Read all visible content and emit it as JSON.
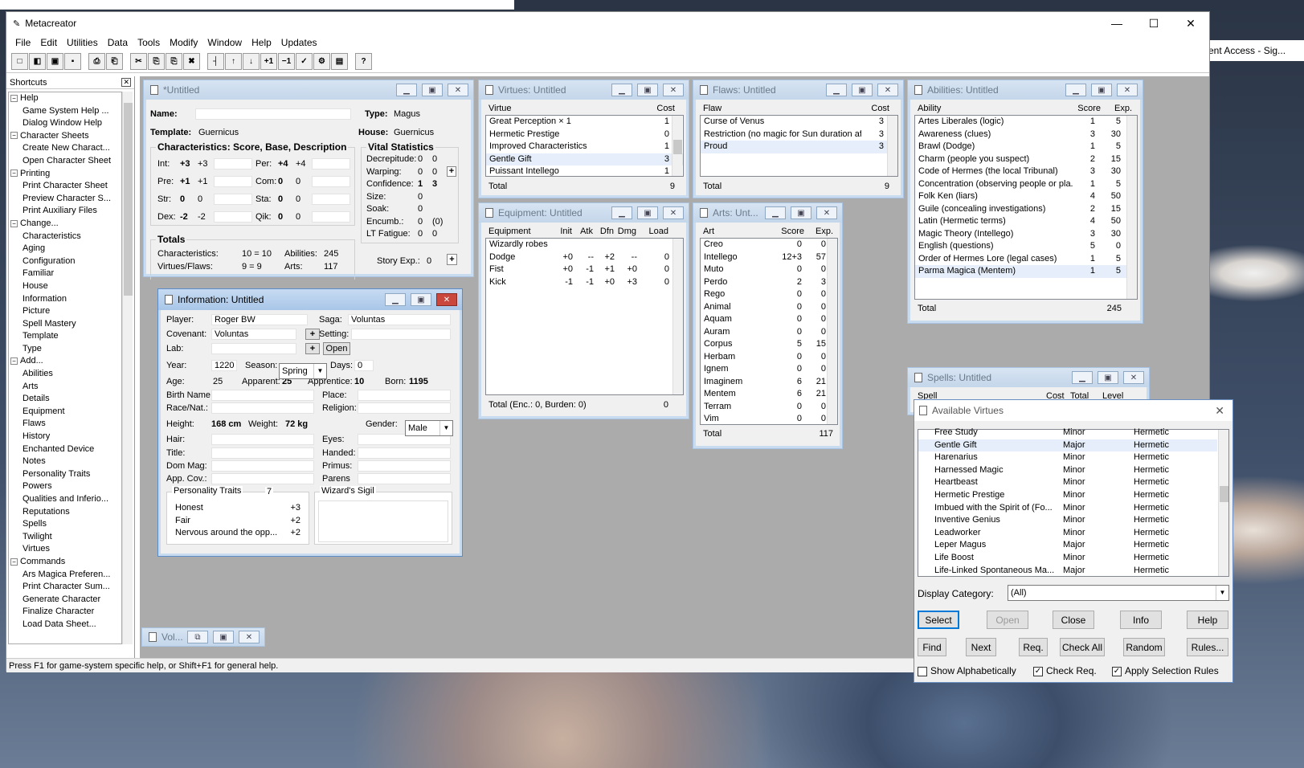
{
  "browser": {
    "right_tab_text": "ent Access - Sig..."
  },
  "app": {
    "title": "Metacreator",
    "min": "—",
    "max": "☐",
    "close": "✕"
  },
  "menu": [
    "File",
    "Edit",
    "Utilities",
    "Data",
    "Tools",
    "Modify",
    "Window",
    "Help",
    "Updates"
  ],
  "toolbar": [
    "□",
    "◧",
    "▣",
    "▪",
    "⎙",
    "⎗",
    "✂",
    "⎘",
    "⎘",
    "✖",
    "┤",
    "↑",
    "↓",
    "+1",
    "−1",
    "✓",
    "⚙",
    "▤",
    "?"
  ],
  "shortcuts": {
    "title": "Shortcuts",
    "close": "✕",
    "items": [
      {
        "t": "g",
        "label": "Help"
      },
      {
        "t": "s",
        "label": "Game System Help ..."
      },
      {
        "t": "s",
        "label": "Dialog Window Help"
      },
      {
        "t": "g",
        "label": "Character Sheets"
      },
      {
        "t": "s",
        "label": "Create New Charact..."
      },
      {
        "t": "s",
        "label": "Open Character Sheet"
      },
      {
        "t": "g",
        "label": "Printing"
      },
      {
        "t": "s",
        "label": "Print Character Sheet"
      },
      {
        "t": "s",
        "label": "Preview Character S..."
      },
      {
        "t": "s",
        "label": "Print Auxiliary Files"
      },
      {
        "t": "g",
        "label": "Change..."
      },
      {
        "t": "s",
        "label": "Characteristics"
      },
      {
        "t": "s",
        "label": "Aging"
      },
      {
        "t": "s",
        "label": "Configuration"
      },
      {
        "t": "s",
        "label": "Familiar"
      },
      {
        "t": "s",
        "label": "House"
      },
      {
        "t": "s",
        "label": "Information"
      },
      {
        "t": "s",
        "label": "Picture"
      },
      {
        "t": "s",
        "label": "Spell Mastery"
      },
      {
        "t": "s",
        "label": "Template"
      },
      {
        "t": "s",
        "label": "Type"
      },
      {
        "t": "g",
        "label": "Add..."
      },
      {
        "t": "s",
        "label": "Abilities"
      },
      {
        "t": "s",
        "label": "Arts"
      },
      {
        "t": "s",
        "label": "Details"
      },
      {
        "t": "s",
        "label": "Equipment"
      },
      {
        "t": "s",
        "label": "Flaws"
      },
      {
        "t": "s",
        "label": "History"
      },
      {
        "t": "s",
        "label": "Enchanted Device"
      },
      {
        "t": "s",
        "label": "Notes"
      },
      {
        "t": "s",
        "label": "Personality Traits"
      },
      {
        "t": "s",
        "label": "Powers"
      },
      {
        "t": "s",
        "label": "Qualities and Inferio..."
      },
      {
        "t": "s",
        "label": "Reputations"
      },
      {
        "t": "s",
        "label": "Spells"
      },
      {
        "t": "s",
        "label": "Twilight"
      },
      {
        "t": "s",
        "label": "Virtues"
      },
      {
        "t": "g",
        "label": "Commands"
      },
      {
        "t": "s",
        "label": "Ars Magica Preferen..."
      },
      {
        "t": "s",
        "label": "Print Character Sum..."
      },
      {
        "t": "s",
        "label": "Generate Character"
      },
      {
        "t": "s",
        "label": "Finalize Character"
      },
      {
        "t": "s",
        "label": "Load Data Sheet..."
      }
    ]
  },
  "status": "Press F1 for game-system specific help, or Shift+F1 for general help.",
  "char": {
    "title": "*Untitled",
    "name_label": "Name:",
    "name": "",
    "type_label": "Type:",
    "type": "Magus",
    "template_label": "Template:",
    "template": "Guernicus",
    "house_label": "House:",
    "house": "Guernicus",
    "chars_title": "Characteristics: Score, Base, Description",
    "chars": [
      {
        "k": "Int:",
        "s": "+3",
        "b": "+3"
      },
      {
        "k": "Pre:",
        "s": "+1",
        "b": "+1"
      },
      {
        "k": "Str:",
        "s": "0",
        "b": "0"
      },
      {
        "k": "Dex:",
        "s": "-2",
        "b": "-2"
      },
      {
        "k": "Per:",
        "s": "+4",
        "b": "+4"
      },
      {
        "k": "Com:",
        "s": "0",
        "b": "0"
      },
      {
        "k": "Sta:",
        "s": "0",
        "b": "0"
      },
      {
        "k": "Qik:",
        "s": "0",
        "b": "0"
      }
    ],
    "vital_title": "Vital Statistics",
    "vital": [
      {
        "k": "Decrepitude:",
        "a": "0",
        "b": "0"
      },
      {
        "k": "Warping:",
        "a": "0",
        "b": "0"
      },
      {
        "k": "Confidence:",
        "a": "1",
        "b": "3"
      },
      {
        "k": "Size:",
        "a": "0",
        "b": ""
      },
      {
        "k": "Soak:",
        "a": "0",
        "b": ""
      },
      {
        "k": "Encumb.:",
        "a": "0",
        "b": "(0)"
      },
      {
        "k": "LT Fatigue:",
        "a": "0",
        "b": "0"
      }
    ],
    "totals_title": "Totals",
    "tot_chars_label": "Characteristics:",
    "tot_chars": "10  =  10",
    "tot_abil_label": "Abilities:",
    "tot_abil": "245",
    "tot_vf_label": "Virtues/Flaws:",
    "tot_vf": "9  =  9",
    "tot_arts_label": "Arts:",
    "tot_arts": "117",
    "story_label": "Story Exp.:",
    "story": "0",
    "plus": "+"
  },
  "virtues": {
    "title": "Virtues: Untitled",
    "h1": "Virtue",
    "h2": "Cost",
    "rows": [
      {
        "n": "Great Perception × 1",
        "c": "1"
      },
      {
        "n": "Hermetic Prestige",
        "c": "0"
      },
      {
        "n": "Improved Characteristics",
        "c": "1"
      },
      {
        "n": "Gentle Gift",
        "c": "3"
      },
      {
        "n": "Puissant Intellego",
        "c": "1"
      }
    ],
    "total_label": "Total",
    "total": "9"
  },
  "flaws": {
    "title": "Flaws: Untitled",
    "h1": "Flaw",
    "h2": "Cost",
    "rows": [
      {
        "n": "Curse of Venus",
        "c": "3"
      },
      {
        "n": "Restriction (no magic for Sun duration af...",
        "c": "3"
      },
      {
        "n": "Proud",
        "c": "3"
      }
    ],
    "total_label": "Total",
    "total": "9"
  },
  "abilities": {
    "title": "Abilities: Untitled",
    "h1": "Ability",
    "h2": "Score",
    "h3": "Exp.",
    "rows": [
      {
        "n": "Artes Liberales (logic)",
        "s": "1",
        "e": "5"
      },
      {
        "n": "Awareness (clues)",
        "s": "3",
        "e": "30"
      },
      {
        "n": "Brawl (Dodge)",
        "s": "1",
        "e": "5"
      },
      {
        "n": "Charm (people you suspect)",
        "s": "2",
        "e": "15"
      },
      {
        "n": "Code of Hermes (the local Tribunal)",
        "s": "3",
        "e": "30"
      },
      {
        "n": "Concentration (observing people or pla...",
        "s": "1",
        "e": "5"
      },
      {
        "n": "Folk Ken (liars)",
        "s": "4",
        "e": "50"
      },
      {
        "n": "Guile (concealing investigations)",
        "s": "2",
        "e": "15"
      },
      {
        "n": "Latin (Hermetic terms)",
        "s": "4",
        "e": "50"
      },
      {
        "n": "Magic Theory (Intellego)",
        "s": "3",
        "e": "30"
      },
      {
        "n": "English (questions)",
        "s": "5",
        "e": "0"
      },
      {
        "n": "Order of Hermes Lore (legal cases)",
        "s": "1",
        "e": "5"
      },
      {
        "n": "Parma Magica (Mentem)",
        "s": "1",
        "e": "5"
      }
    ],
    "total_label": "Total",
    "total": "245"
  },
  "equipment": {
    "title": "Equipment: Untitled",
    "heads": [
      "Equipment",
      "Init",
      "Atk",
      "Dfn",
      "Dmg",
      "Load"
    ],
    "rows": [
      {
        "n": "Wizardly robes",
        "i": "",
        "a": "",
        "d": "",
        "g": "",
        "l": ""
      },
      {
        "n": "Dodge",
        "i": "+0",
        "a": "--",
        "d": "+2",
        "g": "--",
        "l": "0"
      },
      {
        "n": "Fist",
        "i": "+0",
        "a": "-1",
        "d": "+1",
        "g": "+0",
        "l": "0"
      },
      {
        "n": "Kick",
        "i": "-1",
        "a": "-1",
        "d": "+0",
        "g": "+3",
        "l": "0"
      }
    ],
    "total_label": "Total (Enc.: 0, Burden: 0)",
    "total": "0"
  },
  "arts": {
    "title": "Arts: Unt...",
    "h1": "Art",
    "h2": "Score",
    "h3": "Exp.",
    "rows": [
      {
        "n": "Creo",
        "s": "0",
        "e": "0"
      },
      {
        "n": "Intellego",
        "s": "12+3",
        "e": "57"
      },
      {
        "n": "Muto",
        "s": "0",
        "e": "0"
      },
      {
        "n": "Perdo",
        "s": "2",
        "e": "3"
      },
      {
        "n": "Rego",
        "s": "0",
        "e": "0"
      },
      {
        "n": "Animal",
        "s": "0",
        "e": "0"
      },
      {
        "n": "Aquam",
        "s": "0",
        "e": "0"
      },
      {
        "n": "Auram",
        "s": "0",
        "e": "0"
      },
      {
        "n": "Corpus",
        "s": "5",
        "e": "15"
      },
      {
        "n": "Herbam",
        "s": "0",
        "e": "0"
      },
      {
        "n": "Ignem",
        "s": "0",
        "e": "0"
      },
      {
        "n": "Imaginem",
        "s": "6",
        "e": "21"
      },
      {
        "n": "Mentem",
        "s": "6",
        "e": "21"
      },
      {
        "n": "Terram",
        "s": "0",
        "e": "0"
      },
      {
        "n": "Vim",
        "s": "0",
        "e": "0"
      }
    ],
    "total_label": "Total",
    "total": "117"
  },
  "spells": {
    "title": "Spells: Untitled",
    "h1": "Spell",
    "h2": "Cost",
    "h3": "Total",
    "h4": "Level"
  },
  "minimized": {
    "title": "Vol..."
  },
  "info": {
    "title": "Information: Untitled",
    "player_label": "Player:",
    "player": "Roger BW",
    "saga_label": "Saga:",
    "saga": "Voluntas",
    "covenant_label": "Covenant:",
    "covenant": "Voluntas",
    "setting_label": "Setting:",
    "setting": "",
    "lab_label": "Lab:",
    "lab": "",
    "open": "Open",
    "plus": "+",
    "year_label": "Year:",
    "year": "1220",
    "season_label": "Season:",
    "season": "Spring",
    "days_label": "Days:",
    "days": "0",
    "age_label": "Age:",
    "age": "25",
    "apparent_label": "Apparent:",
    "apparent": "25",
    "apprentice_label": "Apprentice:",
    "apprentice": "10",
    "born_label": "Born:",
    "born": "1195",
    "birthname_label": "Birth Name:",
    "place_label": "Place:",
    "race_label": "Race/Nat.:",
    "religion_label": "Religion:",
    "height_label": "Height:",
    "height": "168 cm",
    "weight_label": "Weight:",
    "weight": "72 kg",
    "gender_label": "Gender:",
    "gender": "Male",
    "hair_label": "Hair:",
    "eyes_label": "Eyes:",
    "title_label": "Title:",
    "handed_label": "Handed:",
    "dommag_label": "Dom Mag:",
    "primus_label": "Primus:",
    "appcov_label": "App. Cov.:",
    "parens_label": "Parens",
    "pt_title": "Personality Traits",
    "pt_count": "7",
    "traits": [
      {
        "n": "Honest",
        "v": "+3"
      },
      {
        "n": "Fair",
        "v": "+2"
      },
      {
        "n": "Nervous around the opp...",
        "v": "+2"
      }
    ],
    "sigil_title": "Wizard's Sigil"
  },
  "avail": {
    "title": "Available Virtues",
    "rows": [
      {
        "n": "Free Study",
        "t": "Minor",
        "c": "Hermetic"
      },
      {
        "n": "Gentle Gift",
        "t": "Major",
        "c": "Hermetic"
      },
      {
        "n": "Harenarius",
        "t": "Minor",
        "c": "Hermetic"
      },
      {
        "n": "Harnessed Magic",
        "t": "Minor",
        "c": "Hermetic"
      },
      {
        "n": "Heartbeast",
        "t": "Minor",
        "c": "Hermetic"
      },
      {
        "n": "Hermetic Prestige",
        "t": "Minor",
        "c": "Hermetic"
      },
      {
        "n": "Imbued with the Spirit of (Fo...",
        "t": "Minor",
        "c": "Hermetic"
      },
      {
        "n": "Inventive Genius",
        "t": "Minor",
        "c": "Hermetic"
      },
      {
        "n": "Leadworker",
        "t": "Minor",
        "c": "Hermetic"
      },
      {
        "n": "Leper Magus",
        "t": "Major",
        "c": "Hermetic"
      },
      {
        "n": "Life Boost",
        "t": "Minor",
        "c": "Hermetic"
      },
      {
        "n": "Life-Linked Spontaneous Ma...",
        "t": "Major",
        "c": "Hermetic"
      }
    ],
    "cat_label": "Display Category:",
    "cat": "(All)",
    "buttons1": [
      "Select",
      "Open",
      "Close",
      "Info",
      "Help"
    ],
    "buttons2": [
      "Find",
      "Next",
      "Req.",
      "Check All",
      "Random",
      "Rules..."
    ],
    "show_alpha": "Show Alphabetically",
    "check_req": "Check Req.",
    "apply_rules": "Apply Selection Rules",
    "check": "✓"
  }
}
